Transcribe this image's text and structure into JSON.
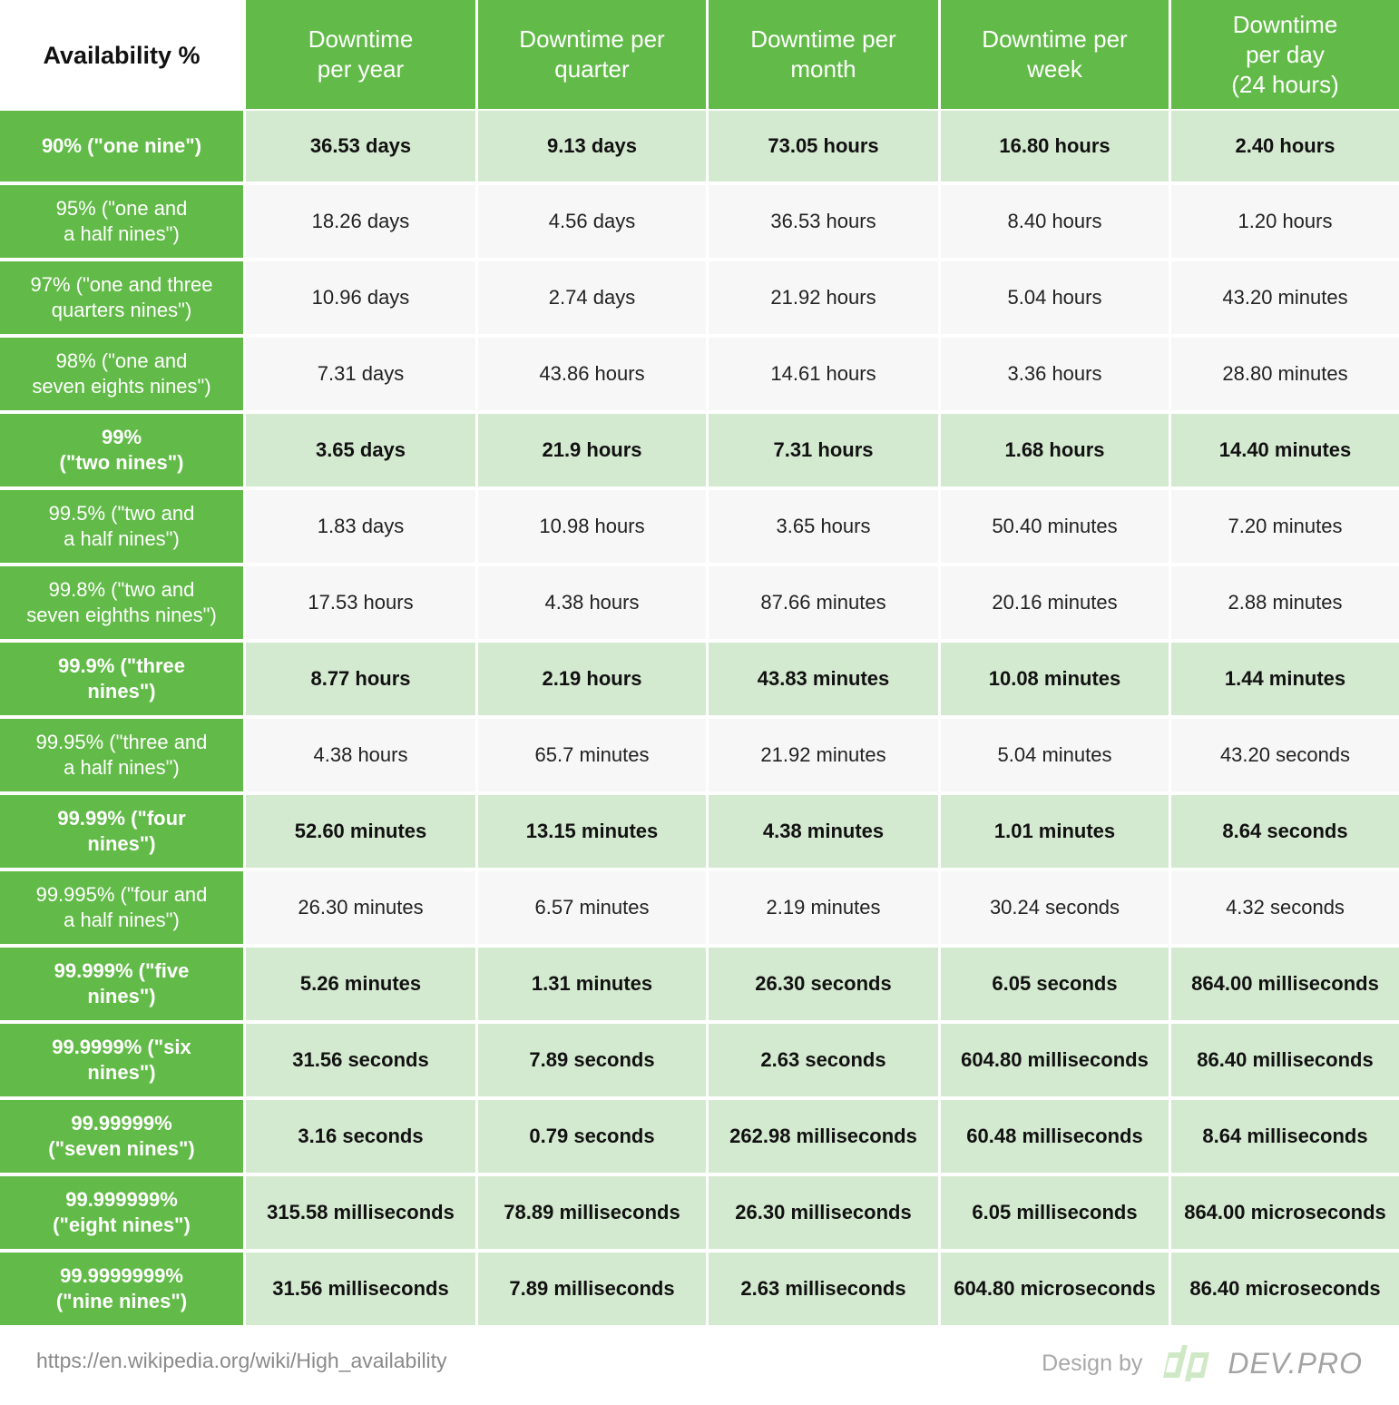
{
  "header": {
    "corner": "Availability %",
    "columns": [
      "Downtime\nper year",
      "Downtime per\nquarter",
      "Downtime per\nmonth",
      "Downtime per\nweek",
      "Downtime\nper day\n(24 hours)"
    ]
  },
  "rows": [
    {
      "label": "90% (\"one nine\")",
      "highlight": true,
      "values": [
        "36.53 days",
        "9.13 days",
        "73.05 hours",
        "16.80 hours",
        "2.40 hours"
      ]
    },
    {
      "label": "95% (\"one and\na half nines\")",
      "highlight": false,
      "values": [
        "18.26 days",
        "4.56 days",
        "36.53 hours",
        "8.40 hours",
        "1.20 hours"
      ]
    },
    {
      "label": "97% (\"one and three\nquarters nines\")",
      "highlight": false,
      "values": [
        "10.96 days",
        "2.74 days",
        "21.92 hours",
        "5.04 hours",
        "43.20 minutes"
      ]
    },
    {
      "label": "98% (\"one and\nseven eights nines\")",
      "highlight": false,
      "values": [
        "7.31 days",
        "43.86 hours",
        "14.61 hours",
        "3.36 hours",
        "28.80 minutes"
      ]
    },
    {
      "label": "99%\n(\"two nines\")",
      "highlight": true,
      "values": [
        "3.65 days",
        "21.9 hours",
        "7.31 hours",
        "1.68 hours",
        "14.40 minutes"
      ]
    },
    {
      "label": "99.5% (\"two and\na half nines\")",
      "highlight": false,
      "values": [
        "1.83 days",
        "10.98 hours",
        "3.65 hours",
        "50.40 minutes",
        "7.20 minutes"
      ]
    },
    {
      "label": "99.8% (\"two and\nseven eighths nines\")",
      "highlight": false,
      "values": [
        "17.53 hours",
        "4.38 hours",
        "87.66 minutes",
        "20.16 minutes",
        "2.88 minutes"
      ]
    },
    {
      "label": "99.9% (\"three\nnines\")",
      "highlight": true,
      "values": [
        "8.77 hours",
        "2.19 hours",
        "43.83 minutes",
        "10.08 minutes",
        "1.44 minutes"
      ]
    },
    {
      "label": "99.95% (\"three and\na half nines\")",
      "highlight": false,
      "values": [
        "4.38 hours",
        "65.7 minutes",
        "21.92 minutes",
        "5.04 minutes",
        "43.20 seconds"
      ]
    },
    {
      "label": "99.99% (\"four\nnines\")",
      "highlight": true,
      "values": [
        "52.60 minutes",
        "13.15 minutes",
        "4.38 minutes",
        "1.01 minutes",
        "8.64 seconds"
      ]
    },
    {
      "label": "99.995% (\"four and\na half nines\")",
      "highlight": false,
      "values": [
        "26.30 minutes",
        "6.57 minutes",
        "2.19 minutes",
        "30.24 seconds",
        "4.32 seconds"
      ]
    },
    {
      "label": "99.999% (\"five\nnines\")",
      "highlight": true,
      "values": [
        "5.26 minutes",
        "1.31 minutes",
        "26.30 seconds",
        "6.05 seconds",
        "864.00 milliseconds"
      ]
    },
    {
      "label": "99.9999% (\"six\nnines\")",
      "highlight": true,
      "values": [
        "31.56 seconds",
        "7.89 seconds",
        "2.63 seconds",
        "604.80 milliseconds",
        "86.40 milliseconds"
      ]
    },
    {
      "label": "99.99999%\n(\"seven nines\")",
      "highlight": true,
      "values": [
        "3.16 seconds",
        "0.79 seconds",
        "262.98 milliseconds",
        "60.48 milliseconds",
        "8.64 milliseconds"
      ]
    },
    {
      "label": "99.999999%\n(\"eight nines\")",
      "highlight": true,
      "values": [
        "315.58 milliseconds",
        "78.89 milliseconds",
        "26.30 milliseconds",
        "6.05 milliseconds",
        "864.00 microseconds"
      ]
    },
    {
      "label": "99.9999999%\n(\"nine nines\")",
      "highlight": true,
      "values": [
        "31.56 milliseconds",
        "7.89 milliseconds",
        "2.63 milliseconds",
        "604.80 microseconds",
        "86.40 microseconds"
      ]
    }
  ],
  "footer": {
    "source": "https://en.wikipedia.org/wiki/High_availability",
    "design_by": "Design by",
    "logo_mark": "dp",
    "brand": "DEV.PRO"
  },
  "colors": {
    "header_green": "#62bb48",
    "highlight_row": "#d4ead0",
    "plain_row": "#f7f7f7",
    "logo_green": "#cfe9c6"
  }
}
